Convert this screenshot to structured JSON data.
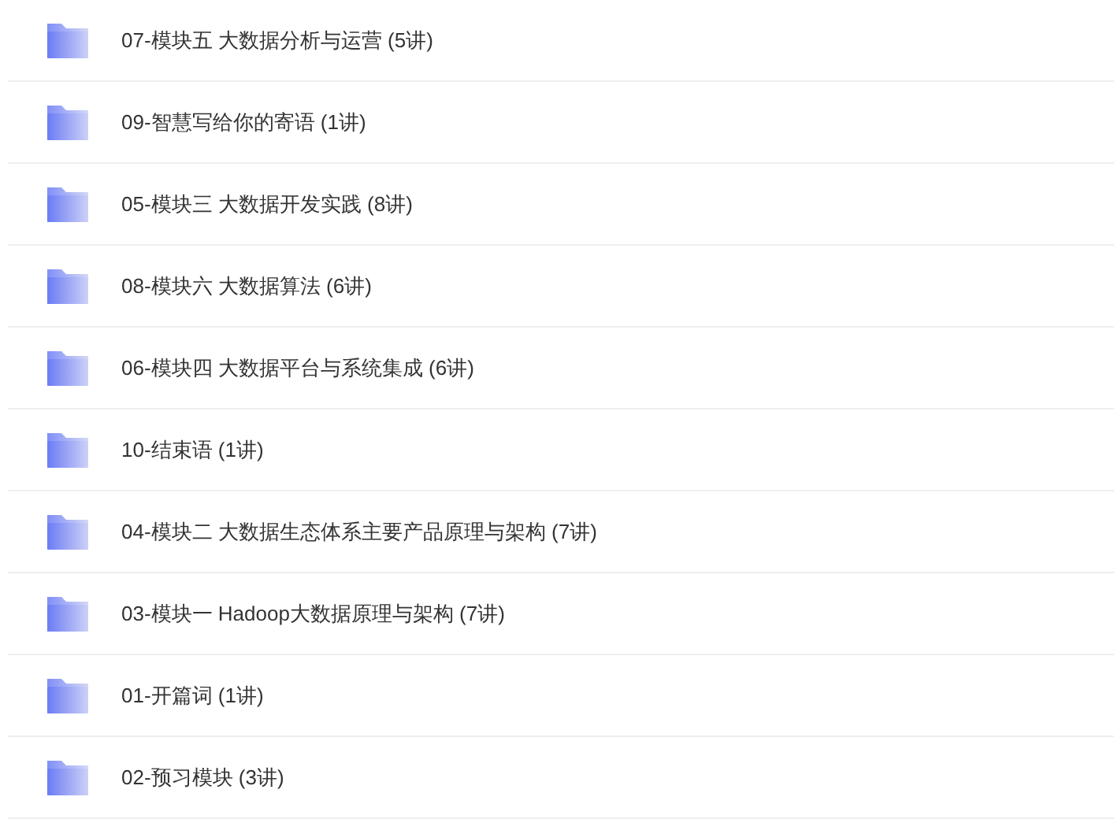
{
  "folders": [
    {
      "name": "07-模块五 大数据分析与运营 (5讲)"
    },
    {
      "name": "09-智慧写给你的寄语 (1讲)"
    },
    {
      "name": "05-模块三 大数据开发实践 (8讲)"
    },
    {
      "name": "08-模块六 大数据算法 (6讲)"
    },
    {
      "name": "06-模块四 大数据平台与系统集成 (6讲)"
    },
    {
      "name": "10-结束语 (1讲)"
    },
    {
      "name": "04-模块二 大数据生态体系主要产品原理与架构 (7讲)"
    },
    {
      "name": "03-模块一 Hadoop大数据原理与架构 (7讲)"
    },
    {
      "name": "01-开篇词 (1讲)"
    },
    {
      "name": "02-预习模块 (3讲)"
    }
  ]
}
